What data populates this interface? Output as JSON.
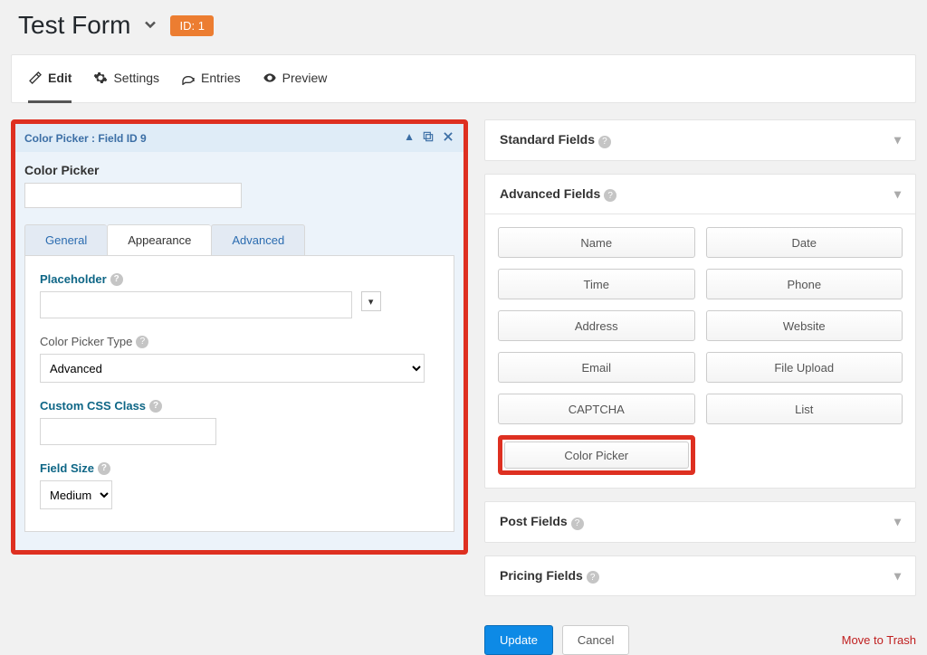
{
  "header": {
    "title": "Test Form",
    "id_badge": "ID: 1"
  },
  "nav": {
    "edit": "Edit",
    "settings": "Settings",
    "entries": "Entries",
    "preview": "Preview"
  },
  "editor": {
    "header_text": "Color Picker : Field ID 9",
    "field_label": "Color Picker",
    "tabs": {
      "general": "General",
      "appearance": "Appearance",
      "advanced": "Advanced"
    },
    "settings": {
      "placeholder_label": "Placeholder",
      "placeholder_value": "",
      "type_label": "Color Picker Type",
      "type_value": "Advanced",
      "css_label": "Custom CSS Class",
      "css_value": "",
      "size_label": "Field Size",
      "size_value": "Medium"
    }
  },
  "panels": {
    "standard": "Standard Fields",
    "advanced": "Advanced Fields",
    "post": "Post Fields",
    "pricing": "Pricing Fields",
    "fields": {
      "name": "Name",
      "date": "Date",
      "time": "Time",
      "phone": "Phone",
      "address": "Address",
      "website": "Website",
      "email": "Email",
      "fileupload": "File Upload",
      "captcha": "CAPTCHA",
      "list": "List",
      "colorpicker": "Color Picker"
    }
  },
  "actions": {
    "update": "Update",
    "cancel": "Cancel",
    "trash": "Move to Trash"
  }
}
